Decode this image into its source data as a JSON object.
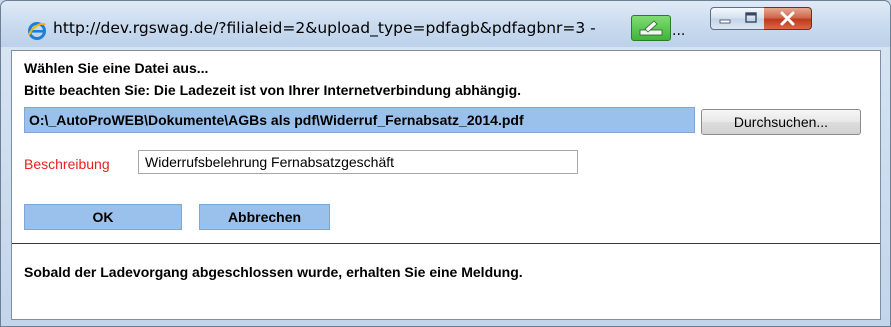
{
  "window": {
    "title_url": "http://dev.rgswag.de/?filialeid=2&upload_type=pdfagb&pdfagbnr=3 -",
    "title_ellipsis": "...",
    "icon": "ie-icon",
    "controls": [
      "minimize-icon",
      "maximize-icon",
      "close-icon"
    ],
    "colors": {
      "close": "#c0391c",
      "field_blue": "#99c1ec",
      "label_red": "#e8201b"
    }
  },
  "dialog": {
    "heading": "Wählen Sie eine Datei aus...",
    "notice": "Bitte beachten Sie: Die Ladezeit ist von Ihrer Internetverbindung abhängig.",
    "file_path": "O:\\_AutoProWEB\\Dokumente\\AGBs als pdf\\Widerruf_Fernabsatz_2014.pdf",
    "browse_label": "Durchsuchen...",
    "description_label": "Beschreibung",
    "description_value": "Widerrufsbelehrung Fernabsatzgeschäft",
    "ok_label": "OK",
    "cancel_label": "Abbrechen",
    "status_message": "Sobald der Ladevorgang abgeschlossen wurde, erhalten Sie eine Meldung."
  }
}
